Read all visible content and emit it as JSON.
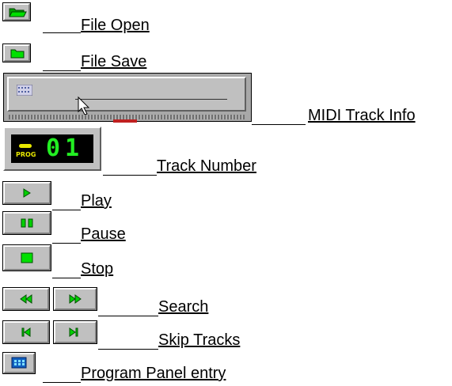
{
  "items": [
    {
      "label": "File Open",
      "icon": "folder-open-icon"
    },
    {
      "label": "File Save",
      "icon": "folder-icon"
    },
    {
      "label": "MIDI Track Info",
      "icon": "slider-icon"
    },
    {
      "label": "Track Number",
      "icon": "lcd-display-icon",
      "lcd_prefix": "PROG",
      "lcd_digits": "01"
    },
    {
      "label": "Play",
      "icon": "play-icon"
    },
    {
      "label": "Pause",
      "icon": "pause-icon"
    },
    {
      "label": "Stop",
      "icon": "stop-icon"
    },
    {
      "label": "Search",
      "icon": "rewind-forward-icon"
    },
    {
      "label": "Skip Tracks",
      "icon": "skip-icon"
    },
    {
      "label": "Program Panel entry",
      "icon": "program-panel-icon"
    }
  ],
  "colors": {
    "button_face": "#c0c0c0",
    "icon_green": "#00c000",
    "lcd_green": "#22ee22",
    "lcd_yellow": "#e8e800",
    "program_blue": "#1060c0"
  }
}
